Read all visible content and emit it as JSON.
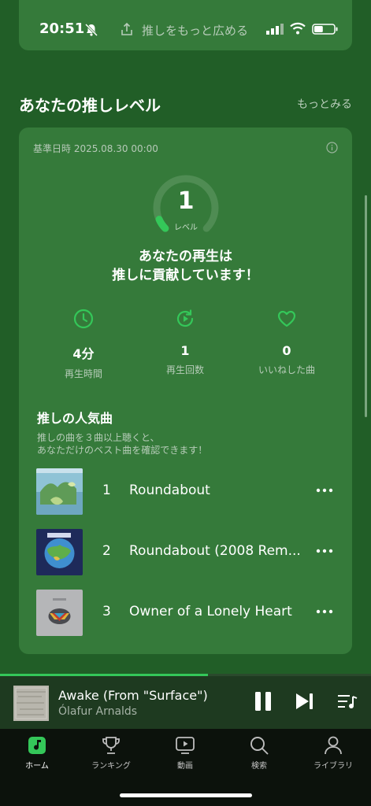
{
  "status_bar": {
    "time": "20:51",
    "share_label": "推しをもっと広める",
    "battery_level": 0.45
  },
  "section": {
    "title": "あなたの推しレベル",
    "more_label": "もっとみる"
  },
  "level_card": {
    "base_date": "基準日時 2025.08.30 00:00",
    "level_value": "1",
    "level_unit": "レベル",
    "level_progress": 0.08,
    "headline_line1": "あなたの再生は",
    "headline_line2": "推しに貢献しています！",
    "stats": [
      {
        "icon": "clock-icon",
        "value": "4分",
        "label": "再生時間"
      },
      {
        "icon": "replay-icon",
        "value": "1",
        "label": "再生回数"
      },
      {
        "icon": "heart-icon",
        "value": "0",
        "label": "いいねした曲"
      }
    ],
    "popular_title": "推しの人気曲",
    "popular_note_line1": "推しの曲を３曲以上聴くと、",
    "popular_note_line2": "あなただけのベスト曲を確認できます！",
    "tracks": [
      {
        "rank": "1",
        "title": "Roundabout"
      },
      {
        "rank": "2",
        "title": "Roundabout (2008 Rem..."
      },
      {
        "rank": "3",
        "title": "Owner of a Lonely Heart"
      }
    ]
  },
  "mini_player": {
    "title": "Awake (From \"Surface\")",
    "artist": "Ólafur Arnalds",
    "progress": 0.56
  },
  "tabs": [
    {
      "label": "ホーム",
      "icon": "home-music-icon",
      "active": true
    },
    {
      "label": "ランキング",
      "icon": "trophy-icon",
      "active": false
    },
    {
      "label": "動画",
      "icon": "video-icon",
      "active": false
    },
    {
      "label": "検索",
      "icon": "search-icon",
      "active": false
    },
    {
      "label": "ライブラリ",
      "icon": "person-icon",
      "active": false
    }
  ],
  "colors": {
    "background": "#215e27",
    "card": "#357a3a",
    "accent": "#34c759",
    "tab_bar": "#0c120c"
  }
}
